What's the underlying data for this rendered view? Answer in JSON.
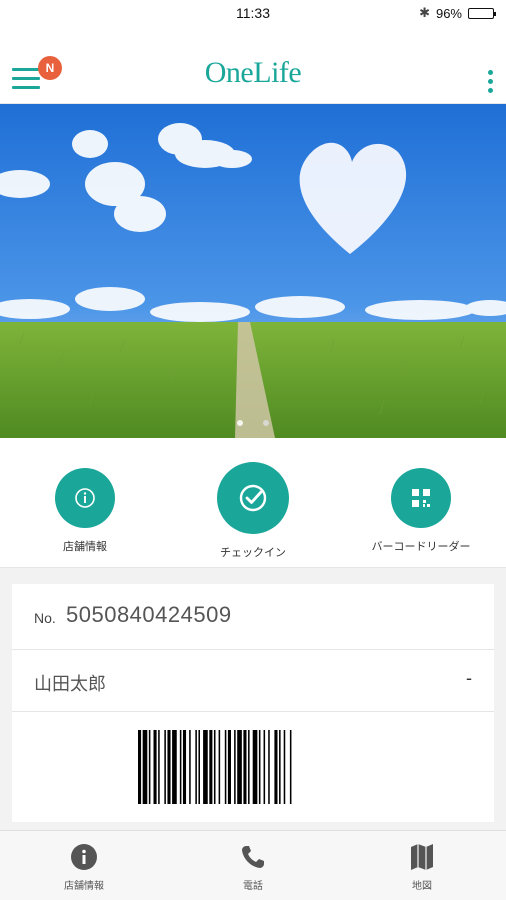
{
  "status_bar": {
    "time": "11:33",
    "battery": "96%"
  },
  "header": {
    "title": "OneLife",
    "badge": "N"
  },
  "hero": {
    "page_count": 2,
    "active_page": 1
  },
  "actions": [
    {
      "label": "店舗情報",
      "icon": "info-icon"
    },
    {
      "label": "チェックイン",
      "icon": "check-icon"
    },
    {
      "label": "バーコードリーダー",
      "icon": "qr-code-icon"
    }
  ],
  "member": {
    "no_prefix": "No.",
    "number": "5050840424509",
    "name": "山田太郎",
    "rank": "-"
  },
  "tabbar": [
    {
      "label": "店舗情報",
      "icon": "info-icon"
    },
    {
      "label": "電話",
      "icon": "phone-icon"
    },
    {
      "label": "地図",
      "icon": "map-icon"
    }
  ],
  "colors": {
    "accent": "#1aa79a",
    "badge": "#e8603c"
  }
}
